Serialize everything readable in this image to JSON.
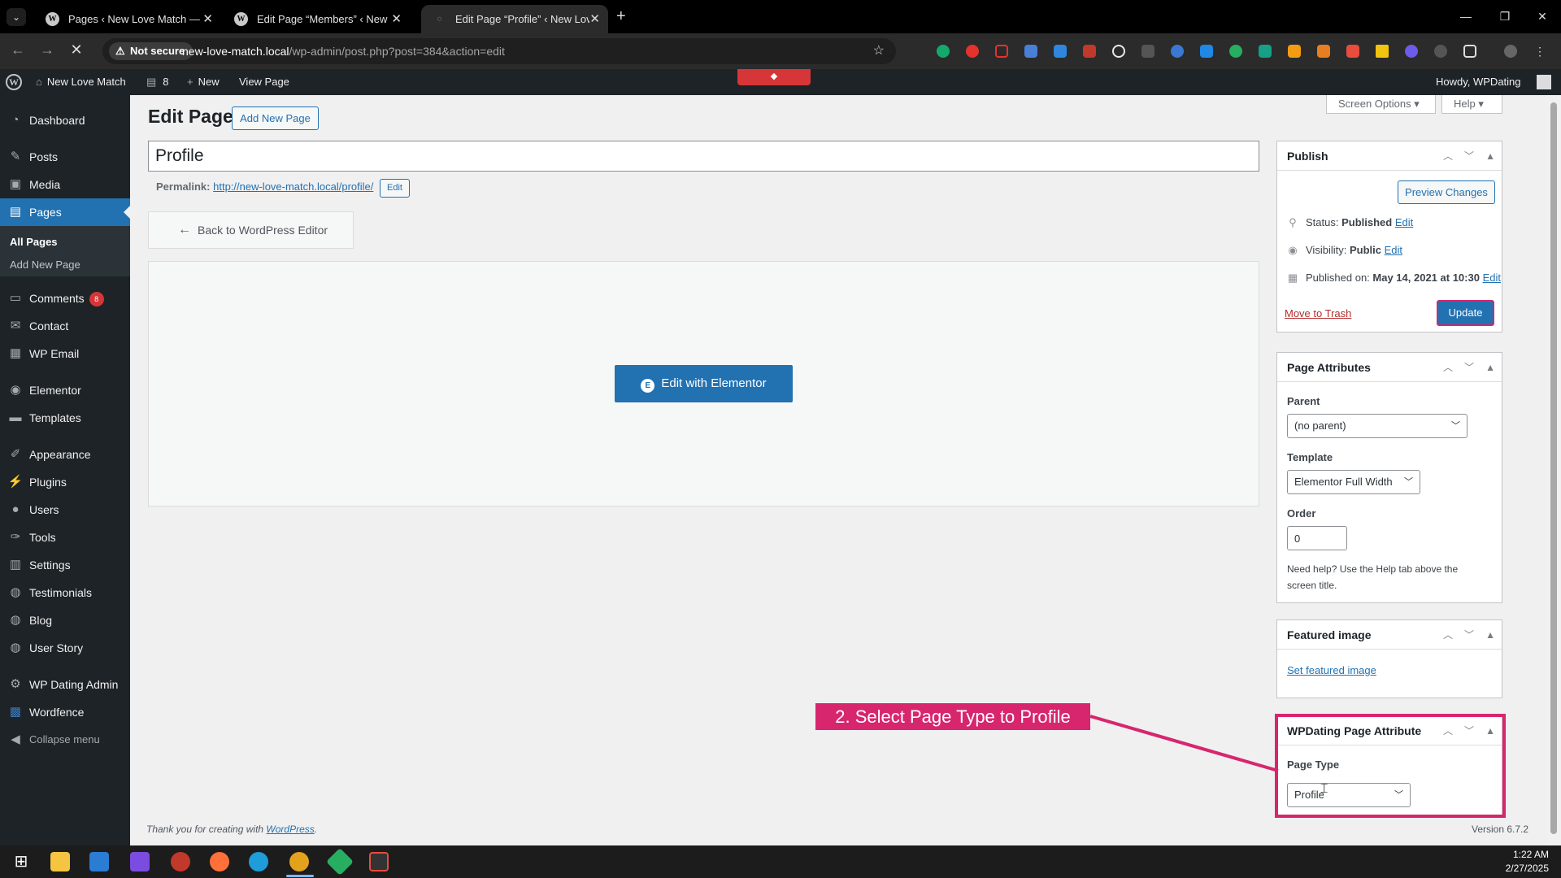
{
  "browser": {
    "tabs": [
      {
        "title": "Pages ‹ New Love Match — Wo"
      },
      {
        "title": "Edit Page “Members” ‹ New Lo"
      },
      {
        "title": "Edit Page “Profile” ‹ New Love M"
      }
    ],
    "address": {
      "security": "Not secure",
      "host": "new-love-match.local",
      "path": "/wp-admin/post.php?post=384&action=edit"
    }
  },
  "adminbar": {
    "site_name": "New Love Match",
    "comments_count": "8",
    "new_label": "New",
    "view_page": "View Page",
    "howdy": "Howdy, WPDating"
  },
  "sidebar": {
    "items": [
      {
        "label": "Dashboard",
        "icon": "dashboard-icon"
      },
      {
        "label": "Posts",
        "icon": "pin-icon"
      },
      {
        "label": "Media",
        "icon": "media-icon"
      },
      {
        "label": "Pages",
        "icon": "pages-icon"
      },
      {
        "label": "Comments",
        "icon": "comment-icon",
        "badge": "8"
      },
      {
        "label": "Contact",
        "icon": "mail-icon"
      },
      {
        "label": "WP Email",
        "icon": "email-icon"
      },
      {
        "label": "Elementor",
        "icon": "elementor-icon"
      },
      {
        "label": "Templates",
        "icon": "folder-icon"
      },
      {
        "label": "Appearance",
        "icon": "brush-icon"
      },
      {
        "label": "Plugins",
        "icon": "plugin-icon"
      },
      {
        "label": "Users",
        "icon": "user-icon"
      },
      {
        "label": "Tools",
        "icon": "wrench-icon"
      },
      {
        "label": "Settings",
        "icon": "settings-icon"
      },
      {
        "label": "Testimonials",
        "icon": "testimonial-icon"
      },
      {
        "label": "Blog",
        "icon": "blog-icon"
      },
      {
        "label": "User Story",
        "icon": "story-icon"
      },
      {
        "label": "WP Dating Admin",
        "icon": "gear-icon"
      },
      {
        "label": "Wordfence",
        "icon": "shield-icon"
      },
      {
        "label": "Collapse menu",
        "icon": "collapse-icon"
      }
    ],
    "submenu": {
      "all_pages": "All Pages",
      "add_new": "Add New Page"
    }
  },
  "main": {
    "screen_options": "Screen Options ▾",
    "help": "Help ▾",
    "heading": "Edit Page",
    "add_new_button": "Add New Page",
    "title_value": "Profile",
    "permalink_label": "Permalink:",
    "permalink_url": "http://new-love-match.local/profile/",
    "permalink_edit": "Edit",
    "back_button": "Back to WordPress Editor",
    "elementor_button": "Edit with Elementor"
  },
  "publish": {
    "title": "Publish",
    "preview": "Preview Changes",
    "status_label": "Status:",
    "status_value": "Published",
    "visibility_label": "Visibility:",
    "visibility_value": "Public",
    "published_label": "Published on:",
    "published_value": "May 14, 2021 at 10:30",
    "edit": "Edit",
    "trash": "Move to Trash",
    "update": "Update"
  },
  "attributes": {
    "title": "Page Attributes",
    "parent_label": "Parent",
    "parent_value": "(no parent)",
    "template_label": "Template",
    "template_value": "Elementor Full Width",
    "order_label": "Order",
    "order_value": "0",
    "help_line1": "Need help? Use the Help tab above the",
    "help_line2": "screen title."
  },
  "featured": {
    "title": "Featured image",
    "link": "Set featured image"
  },
  "wpdating": {
    "title": "WPDating Page Attribute",
    "type_label": "Page Type",
    "type_value": "Profile"
  },
  "annotation": {
    "label": "2. Select Page Type to Profile",
    "color": "#d7266e"
  },
  "footer": {
    "thanks": "Thank you for creating with",
    "wp_link": "WordPress",
    "version": "Version 6.7.2"
  },
  "taskbar": {
    "time": "1:22 AM",
    "date": "2/27/2025"
  }
}
